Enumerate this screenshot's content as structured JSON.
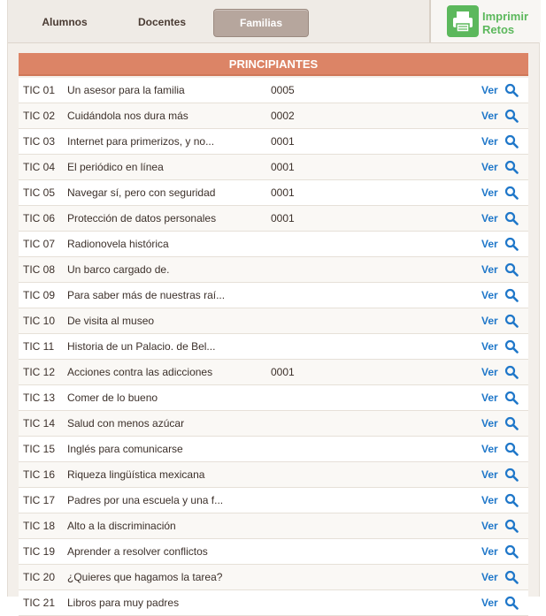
{
  "tabs": [
    {
      "label": "Alumnos",
      "active": false
    },
    {
      "label": "Docentes",
      "active": false
    },
    {
      "label": "Familias",
      "active": true
    }
  ],
  "print": {
    "line1": "Imprimir",
    "line2": "Retos",
    "icon": "printer-icon",
    "color": "#5cb85c"
  },
  "section": {
    "title": "PRINCIPIANTES",
    "color": "#dc8466"
  },
  "ver_label": "Ver",
  "ver_icon": "search-icon",
  "rows": [
    {
      "code": "TIC 01",
      "title": "Un asesor para la familia",
      "count": "0005"
    },
    {
      "code": "TIC 02",
      "title": "Cuidándola nos dura más",
      "count": "0002"
    },
    {
      "code": "TIC 03",
      "title": "Internet para primerizos, y no...",
      "count": "0001"
    },
    {
      "code": "TIC 04",
      "title": "El periódico en línea",
      "count": "0001"
    },
    {
      "code": "TIC 05",
      "title": "Navegar sí, pero con seguridad",
      "count": "0001"
    },
    {
      "code": "TIC 06",
      "title": "Protección de datos personales",
      "count": "0001"
    },
    {
      "code": "TIC 07",
      "title": "Radionovela histórica",
      "count": ""
    },
    {
      "code": "TIC 08",
      "title": "Un barco cargado de.",
      "count": ""
    },
    {
      "code": "TIC 09",
      "title": "Para saber más de nuestras raí...",
      "count": ""
    },
    {
      "code": "TIC 10",
      "title": "De visita al museo",
      "count": ""
    },
    {
      "code": "TIC 11",
      "title": "Historia de un Palacio. de Bel...",
      "count": ""
    },
    {
      "code": "TIC 12",
      "title": "Acciones contra las adicciones",
      "count": "0001"
    },
    {
      "code": "TIC 13",
      "title": "Comer de lo bueno",
      "count": ""
    },
    {
      "code": "TIC 14",
      "title": "Salud con menos azúcar",
      "count": ""
    },
    {
      "code": "TIC 15",
      "title": "Inglés para comunicarse",
      "count": ""
    },
    {
      "code": "TIC 16",
      "title": "Riqueza lingüística mexicana",
      "count": ""
    },
    {
      "code": "TIC 17",
      "title": "Padres por una escuela y una f...",
      "count": ""
    },
    {
      "code": "TIC 18",
      "title": "Alto a la discriminación",
      "count": ""
    },
    {
      "code": "TIC 19",
      "title": "Aprender a resolver conflictos",
      "count": ""
    },
    {
      "code": "TIC 20",
      "title": "¿Quieres que hagamos la tarea?",
      "count": ""
    },
    {
      "code": "TIC 21",
      "title": "Libros para muy padres",
      "count": ""
    }
  ]
}
